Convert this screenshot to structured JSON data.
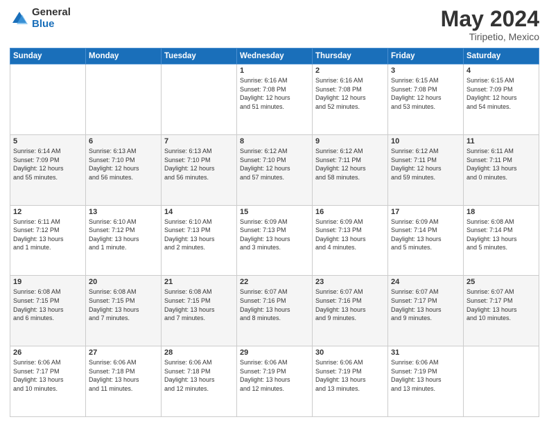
{
  "header": {
    "logo_general": "General",
    "logo_blue": "Blue",
    "title": "May 2024",
    "location": "Tiripetio, Mexico"
  },
  "calendar": {
    "days_of_week": [
      "Sunday",
      "Monday",
      "Tuesday",
      "Wednesday",
      "Thursday",
      "Friday",
      "Saturday"
    ],
    "weeks": [
      [
        {
          "day": "",
          "info": ""
        },
        {
          "day": "",
          "info": ""
        },
        {
          "day": "",
          "info": ""
        },
        {
          "day": "1",
          "info": "Sunrise: 6:16 AM\nSunset: 7:08 PM\nDaylight: 12 hours\nand 51 minutes."
        },
        {
          "day": "2",
          "info": "Sunrise: 6:16 AM\nSunset: 7:08 PM\nDaylight: 12 hours\nand 52 minutes."
        },
        {
          "day": "3",
          "info": "Sunrise: 6:15 AM\nSunset: 7:08 PM\nDaylight: 12 hours\nand 53 minutes."
        },
        {
          "day": "4",
          "info": "Sunrise: 6:15 AM\nSunset: 7:09 PM\nDaylight: 12 hours\nand 54 minutes."
        }
      ],
      [
        {
          "day": "5",
          "info": "Sunrise: 6:14 AM\nSunset: 7:09 PM\nDaylight: 12 hours\nand 55 minutes."
        },
        {
          "day": "6",
          "info": "Sunrise: 6:13 AM\nSunset: 7:10 PM\nDaylight: 12 hours\nand 56 minutes."
        },
        {
          "day": "7",
          "info": "Sunrise: 6:13 AM\nSunset: 7:10 PM\nDaylight: 12 hours\nand 56 minutes."
        },
        {
          "day": "8",
          "info": "Sunrise: 6:12 AM\nSunset: 7:10 PM\nDaylight: 12 hours\nand 57 minutes."
        },
        {
          "day": "9",
          "info": "Sunrise: 6:12 AM\nSunset: 7:11 PM\nDaylight: 12 hours\nand 58 minutes."
        },
        {
          "day": "10",
          "info": "Sunrise: 6:12 AM\nSunset: 7:11 PM\nDaylight: 12 hours\nand 59 minutes."
        },
        {
          "day": "11",
          "info": "Sunrise: 6:11 AM\nSunset: 7:11 PM\nDaylight: 13 hours\nand 0 minutes."
        }
      ],
      [
        {
          "day": "12",
          "info": "Sunrise: 6:11 AM\nSunset: 7:12 PM\nDaylight: 13 hours\nand 1 minute."
        },
        {
          "day": "13",
          "info": "Sunrise: 6:10 AM\nSunset: 7:12 PM\nDaylight: 13 hours\nand 1 minute."
        },
        {
          "day": "14",
          "info": "Sunrise: 6:10 AM\nSunset: 7:13 PM\nDaylight: 13 hours\nand 2 minutes."
        },
        {
          "day": "15",
          "info": "Sunrise: 6:09 AM\nSunset: 7:13 PM\nDaylight: 13 hours\nand 3 minutes."
        },
        {
          "day": "16",
          "info": "Sunrise: 6:09 AM\nSunset: 7:13 PM\nDaylight: 13 hours\nand 4 minutes."
        },
        {
          "day": "17",
          "info": "Sunrise: 6:09 AM\nSunset: 7:14 PM\nDaylight: 13 hours\nand 5 minutes."
        },
        {
          "day": "18",
          "info": "Sunrise: 6:08 AM\nSunset: 7:14 PM\nDaylight: 13 hours\nand 5 minutes."
        }
      ],
      [
        {
          "day": "19",
          "info": "Sunrise: 6:08 AM\nSunset: 7:15 PM\nDaylight: 13 hours\nand 6 minutes."
        },
        {
          "day": "20",
          "info": "Sunrise: 6:08 AM\nSunset: 7:15 PM\nDaylight: 13 hours\nand 7 minutes."
        },
        {
          "day": "21",
          "info": "Sunrise: 6:08 AM\nSunset: 7:15 PM\nDaylight: 13 hours\nand 7 minutes."
        },
        {
          "day": "22",
          "info": "Sunrise: 6:07 AM\nSunset: 7:16 PM\nDaylight: 13 hours\nand 8 minutes."
        },
        {
          "day": "23",
          "info": "Sunrise: 6:07 AM\nSunset: 7:16 PM\nDaylight: 13 hours\nand 9 minutes."
        },
        {
          "day": "24",
          "info": "Sunrise: 6:07 AM\nSunset: 7:17 PM\nDaylight: 13 hours\nand 9 minutes."
        },
        {
          "day": "25",
          "info": "Sunrise: 6:07 AM\nSunset: 7:17 PM\nDaylight: 13 hours\nand 10 minutes."
        }
      ],
      [
        {
          "day": "26",
          "info": "Sunrise: 6:06 AM\nSunset: 7:17 PM\nDaylight: 13 hours\nand 10 minutes."
        },
        {
          "day": "27",
          "info": "Sunrise: 6:06 AM\nSunset: 7:18 PM\nDaylight: 13 hours\nand 11 minutes."
        },
        {
          "day": "28",
          "info": "Sunrise: 6:06 AM\nSunset: 7:18 PM\nDaylight: 13 hours\nand 12 minutes."
        },
        {
          "day": "29",
          "info": "Sunrise: 6:06 AM\nSunset: 7:19 PM\nDaylight: 13 hours\nand 12 minutes."
        },
        {
          "day": "30",
          "info": "Sunrise: 6:06 AM\nSunset: 7:19 PM\nDaylight: 13 hours\nand 13 minutes."
        },
        {
          "day": "31",
          "info": "Sunrise: 6:06 AM\nSunset: 7:19 PM\nDaylight: 13 hours\nand 13 minutes."
        },
        {
          "day": "",
          "info": ""
        }
      ]
    ]
  }
}
